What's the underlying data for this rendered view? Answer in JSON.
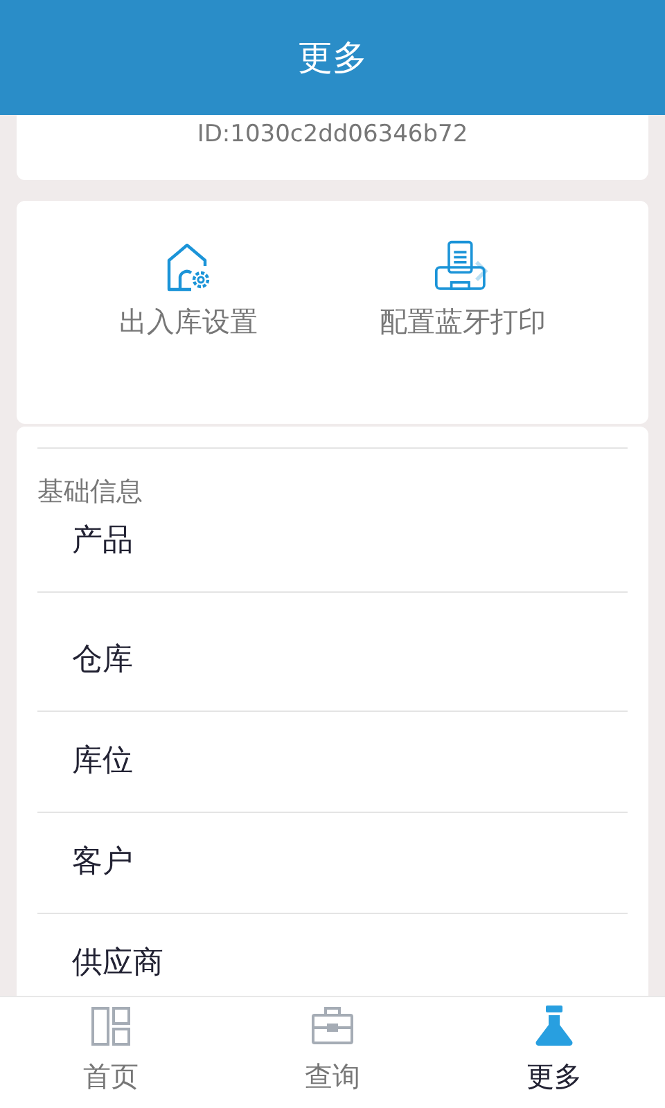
{
  "header": {
    "title": "更多"
  },
  "device": {
    "id": "ID:1030c2dd06346b72"
  },
  "shortcuts": [
    {
      "kind": "warehouse",
      "label": "出入库设置"
    },
    {
      "kind": "printer",
      "label": "配置蓝牙打印"
    }
  ],
  "section": {
    "title": "基础信息",
    "items": [
      "产品",
      "仓库",
      "库位",
      "客户",
      "供应商"
    ]
  },
  "tabs": [
    {
      "kind": "home",
      "label": "首页",
      "selected": false
    },
    {
      "kind": "query",
      "label": "查询",
      "selected": false
    },
    {
      "kind": "more",
      "label": "更多",
      "selected": true
    }
  ]
}
